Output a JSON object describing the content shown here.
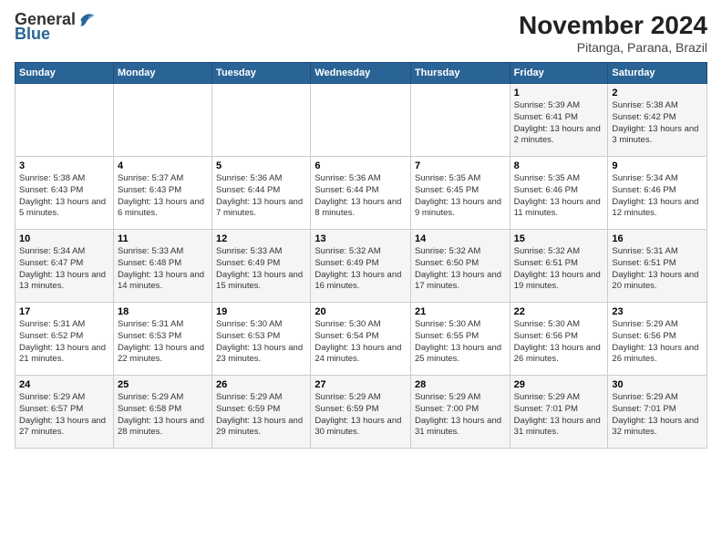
{
  "logo": {
    "general": "General",
    "blue": "Blue"
  },
  "title": "November 2024",
  "location": "Pitanga, Parana, Brazil",
  "weekdays": [
    "Sunday",
    "Monday",
    "Tuesday",
    "Wednesday",
    "Thursday",
    "Friday",
    "Saturday"
  ],
  "weeks": [
    [
      {
        "day": "",
        "info": ""
      },
      {
        "day": "",
        "info": ""
      },
      {
        "day": "",
        "info": ""
      },
      {
        "day": "",
        "info": ""
      },
      {
        "day": "",
        "info": ""
      },
      {
        "day": "1",
        "info": "Sunrise: 5:39 AM\nSunset: 6:41 PM\nDaylight: 13 hours and 2 minutes."
      },
      {
        "day": "2",
        "info": "Sunrise: 5:38 AM\nSunset: 6:42 PM\nDaylight: 13 hours and 3 minutes."
      }
    ],
    [
      {
        "day": "3",
        "info": "Sunrise: 5:38 AM\nSunset: 6:43 PM\nDaylight: 13 hours and 5 minutes."
      },
      {
        "day": "4",
        "info": "Sunrise: 5:37 AM\nSunset: 6:43 PM\nDaylight: 13 hours and 6 minutes."
      },
      {
        "day": "5",
        "info": "Sunrise: 5:36 AM\nSunset: 6:44 PM\nDaylight: 13 hours and 7 minutes."
      },
      {
        "day": "6",
        "info": "Sunrise: 5:36 AM\nSunset: 6:44 PM\nDaylight: 13 hours and 8 minutes."
      },
      {
        "day": "7",
        "info": "Sunrise: 5:35 AM\nSunset: 6:45 PM\nDaylight: 13 hours and 9 minutes."
      },
      {
        "day": "8",
        "info": "Sunrise: 5:35 AM\nSunset: 6:46 PM\nDaylight: 13 hours and 11 minutes."
      },
      {
        "day": "9",
        "info": "Sunrise: 5:34 AM\nSunset: 6:46 PM\nDaylight: 13 hours and 12 minutes."
      }
    ],
    [
      {
        "day": "10",
        "info": "Sunrise: 5:34 AM\nSunset: 6:47 PM\nDaylight: 13 hours and 13 minutes."
      },
      {
        "day": "11",
        "info": "Sunrise: 5:33 AM\nSunset: 6:48 PM\nDaylight: 13 hours and 14 minutes."
      },
      {
        "day": "12",
        "info": "Sunrise: 5:33 AM\nSunset: 6:49 PM\nDaylight: 13 hours and 15 minutes."
      },
      {
        "day": "13",
        "info": "Sunrise: 5:32 AM\nSunset: 6:49 PM\nDaylight: 13 hours and 16 minutes."
      },
      {
        "day": "14",
        "info": "Sunrise: 5:32 AM\nSunset: 6:50 PM\nDaylight: 13 hours and 17 minutes."
      },
      {
        "day": "15",
        "info": "Sunrise: 5:32 AM\nSunset: 6:51 PM\nDaylight: 13 hours and 19 minutes."
      },
      {
        "day": "16",
        "info": "Sunrise: 5:31 AM\nSunset: 6:51 PM\nDaylight: 13 hours and 20 minutes."
      }
    ],
    [
      {
        "day": "17",
        "info": "Sunrise: 5:31 AM\nSunset: 6:52 PM\nDaylight: 13 hours and 21 minutes."
      },
      {
        "day": "18",
        "info": "Sunrise: 5:31 AM\nSunset: 6:53 PM\nDaylight: 13 hours and 22 minutes."
      },
      {
        "day": "19",
        "info": "Sunrise: 5:30 AM\nSunset: 6:53 PM\nDaylight: 13 hours and 23 minutes."
      },
      {
        "day": "20",
        "info": "Sunrise: 5:30 AM\nSunset: 6:54 PM\nDaylight: 13 hours and 24 minutes."
      },
      {
        "day": "21",
        "info": "Sunrise: 5:30 AM\nSunset: 6:55 PM\nDaylight: 13 hours and 25 minutes."
      },
      {
        "day": "22",
        "info": "Sunrise: 5:30 AM\nSunset: 6:56 PM\nDaylight: 13 hours and 26 minutes."
      },
      {
        "day": "23",
        "info": "Sunrise: 5:29 AM\nSunset: 6:56 PM\nDaylight: 13 hours and 26 minutes."
      }
    ],
    [
      {
        "day": "24",
        "info": "Sunrise: 5:29 AM\nSunset: 6:57 PM\nDaylight: 13 hours and 27 minutes."
      },
      {
        "day": "25",
        "info": "Sunrise: 5:29 AM\nSunset: 6:58 PM\nDaylight: 13 hours and 28 minutes."
      },
      {
        "day": "26",
        "info": "Sunrise: 5:29 AM\nSunset: 6:59 PM\nDaylight: 13 hours and 29 minutes."
      },
      {
        "day": "27",
        "info": "Sunrise: 5:29 AM\nSunset: 6:59 PM\nDaylight: 13 hours and 30 minutes."
      },
      {
        "day": "28",
        "info": "Sunrise: 5:29 AM\nSunset: 7:00 PM\nDaylight: 13 hours and 31 minutes."
      },
      {
        "day": "29",
        "info": "Sunrise: 5:29 AM\nSunset: 7:01 PM\nDaylight: 13 hours and 31 minutes."
      },
      {
        "day": "30",
        "info": "Sunrise: 5:29 AM\nSunset: 7:01 PM\nDaylight: 13 hours and 32 minutes."
      }
    ]
  ]
}
